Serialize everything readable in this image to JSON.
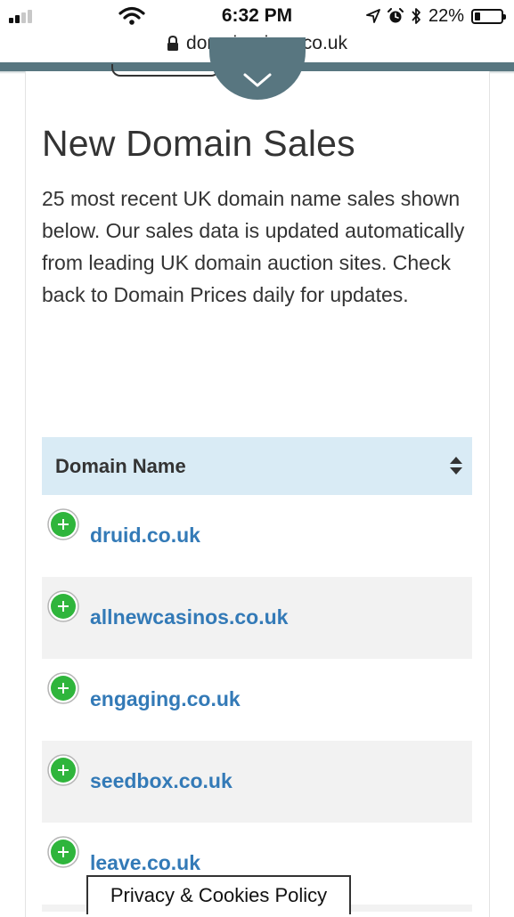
{
  "status": {
    "time": "6:32 PM",
    "battery_percent": "22%",
    "battery_level": 22,
    "signal_bars": 2
  },
  "browser": {
    "url": "domainprices.co.uk"
  },
  "page": {
    "title": "New Domain Sales",
    "intro": "25 most recent UK domain name sales shown below. Our sales data is updated automatically from leading UK domain auction sites. Check back to Domain Prices daily for updates."
  },
  "table": {
    "header": "Domain Name",
    "rows": [
      {
        "domain": "druid.co.uk"
      },
      {
        "domain": "allnewcasinos.co.uk"
      },
      {
        "domain": "engaging.co.uk"
      },
      {
        "domain": "seedbox.co.uk"
      },
      {
        "domain": "leave.co.uk"
      }
    ]
  },
  "footer": {
    "privacy_label": "Privacy & Cookies Policy"
  },
  "colors": {
    "header_bar": "#587680",
    "table_header_bg": "#d9ebf5",
    "link": "#337ab7",
    "expand_green": "#2fb53c"
  },
  "icons": {
    "signal": "cellular-signal-icon",
    "wifi": "wifi-icon",
    "location": "location-arrow-icon",
    "alarm": "alarm-clock-icon",
    "bluetooth": "bluetooth-icon",
    "battery": "battery-icon",
    "lock": "lock-icon",
    "menu": "chevron-down-icon",
    "sort": "sort-icon",
    "expand": "plus-circle-icon"
  }
}
